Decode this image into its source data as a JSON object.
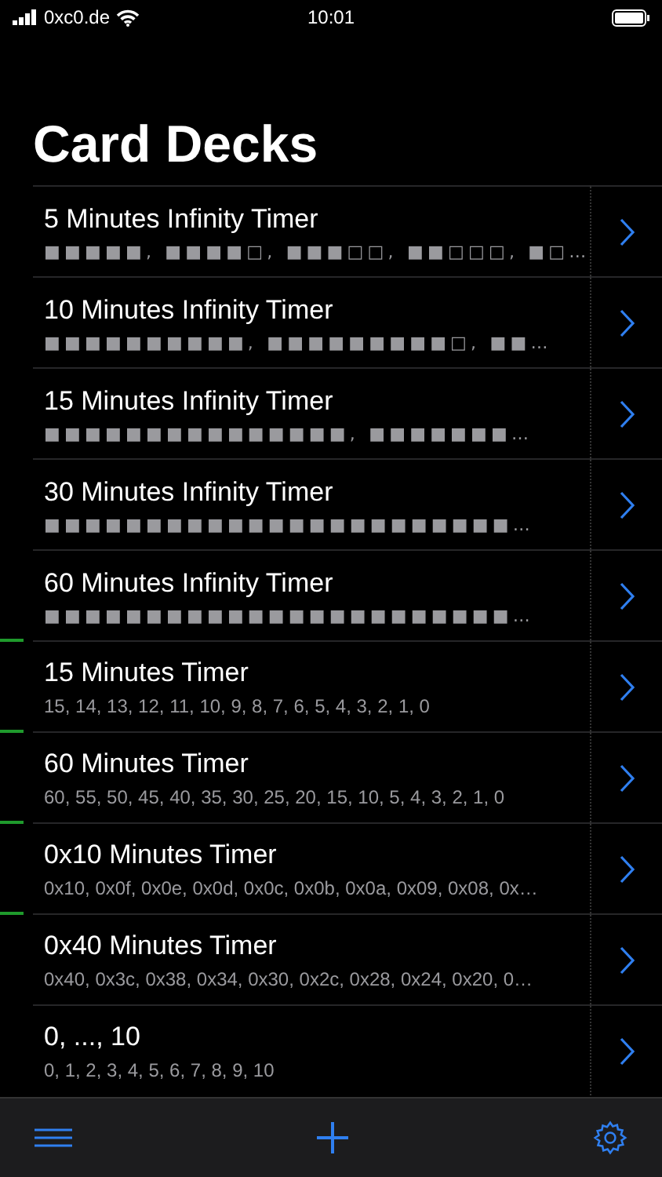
{
  "status_bar": {
    "carrier": "0xc0.de",
    "time": "10:01"
  },
  "title": "Card Decks",
  "decks": [
    {
      "name": "5 Minutes Infinity Timer",
      "preview": "■■■■■, ■■■■□, ■■■□□, ■■□□□, ■□…"
    },
    {
      "name": "10 Minutes Infinity Timer",
      "preview": "■■■■■■■■■■, ■■■■■■■■■□, ■■…"
    },
    {
      "name": "15 Minutes Infinity Timer",
      "preview": "■■■■■■■■■■■■■■■, ■■■■■■■…"
    },
    {
      "name": "30 Minutes Infinity Timer",
      "preview": "■■■■■■■■■■■■■■■■■■■■■■■…"
    },
    {
      "name": "60 Minutes Infinity Timer",
      "preview": "■■■■■■■■■■■■■■■■■■■■■■■…"
    },
    {
      "name": "15 Minutes Timer",
      "preview": "15, 14, 13, 12, 11, 10, 9, 8, 7, 6, 5, 4, 3, 2, 1, 0",
      "color": "#1f9a2c"
    },
    {
      "name": "60 Minutes Timer",
      "preview": "60, 55, 50, 45, 40, 35, 30, 25, 20, 15, 10, 5, 4, 3, 2, 1, 0",
      "color": "#1f9a2c"
    },
    {
      "name": "0x10 Minutes Timer",
      "preview": "0x10, 0x0f, 0x0e, 0x0d, 0x0c, 0x0b, 0x0a, 0x09, 0x08, 0x…",
      "color": "#1f9a2c"
    },
    {
      "name": "0x40 Minutes Timer",
      "preview": "0x40, 0x3c, 0x38, 0x34, 0x30, 0x2c, 0x28, 0x24, 0x20, 0…",
      "color": "#1f9a2c"
    },
    {
      "name": "0, ..., 10",
      "preview": "0, 1, 2, 3, 4, 5, 6, 7, 8, 9, 10"
    }
  ]
}
